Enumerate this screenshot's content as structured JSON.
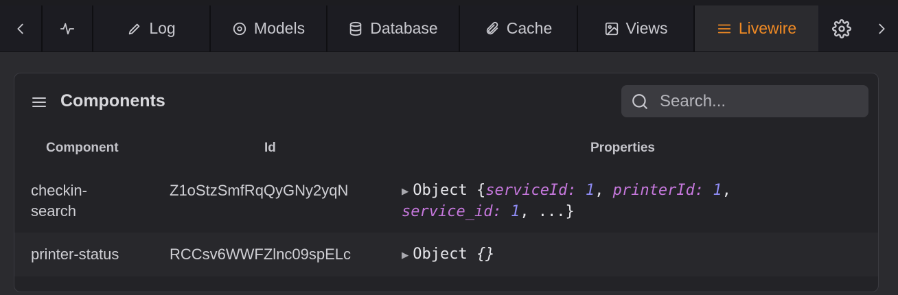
{
  "tabs": [
    {
      "id": "prev",
      "label": "",
      "icon": "chevron-left-icon"
    },
    {
      "id": "activity",
      "label": "",
      "icon": "activity-icon"
    },
    {
      "id": "log",
      "label": "Log",
      "icon": "pencil-icon"
    },
    {
      "id": "models",
      "label": "Models",
      "icon": "target-icon"
    },
    {
      "id": "database",
      "label": "Database",
      "icon": "database-icon"
    },
    {
      "id": "cache",
      "label": "Cache",
      "icon": "paperclip-icon"
    },
    {
      "id": "views",
      "label": "Views",
      "icon": "image-icon"
    },
    {
      "id": "livewire",
      "label": "Livewire",
      "icon": "list-icon",
      "active": true
    },
    {
      "id": "settings",
      "label": "",
      "icon": "gear-icon"
    },
    {
      "id": "next",
      "label": "",
      "icon": "chevron-right-icon"
    }
  ],
  "colors": {
    "accent": "#f08a24",
    "background": "#2b2b2f",
    "panel": "#232327",
    "key": "#c678dd",
    "number": "#8f8cf5"
  },
  "panel": {
    "title": "Components",
    "search_placeholder": "Search...",
    "columns": {
      "component": "Component",
      "id": "Id",
      "properties": "Properties"
    },
    "rows": [
      {
        "component_line1": "checkin-",
        "component_line2": "search",
        "id": "Z1oStzSmfRqQyGNy2yqN",
        "obj_prefix": "Object {",
        "k1": "serviceId:",
        "v1": "1",
        "k2": "printerId:",
        "v2": "1",
        "k3": "service_id:",
        "v3": "1",
        "tail": "...}"
      },
      {
        "component": "printer-status",
        "id": "RCCsv6WWFZlnc09spELc",
        "obj_prefix": "Object",
        "obj_value": "{}"
      }
    ]
  }
}
